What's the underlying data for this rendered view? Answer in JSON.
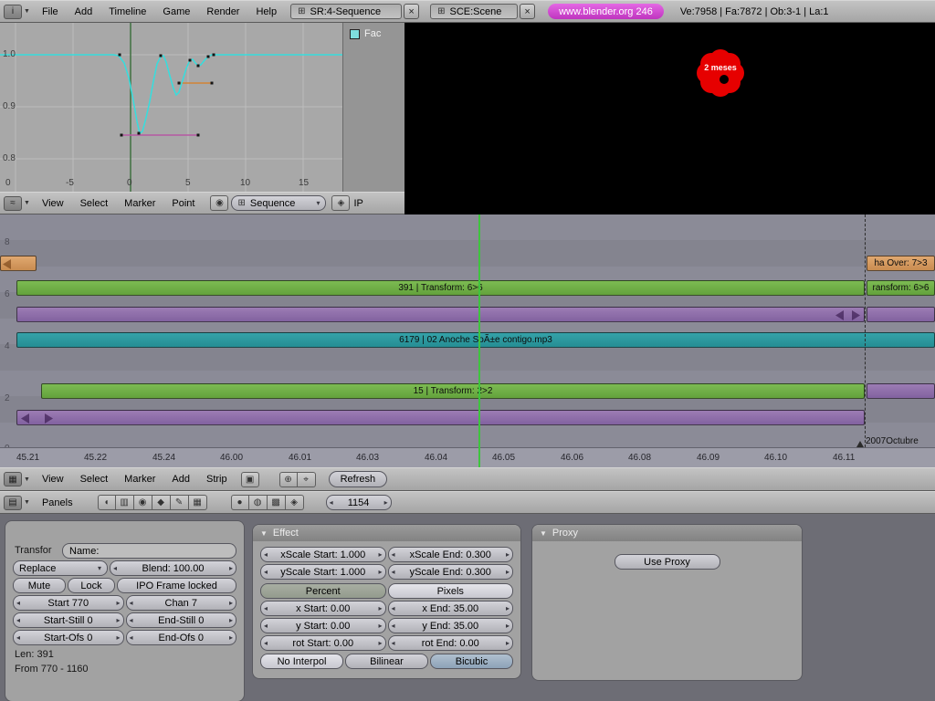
{
  "top_header": {
    "menus": [
      "File",
      "Add",
      "Timeline",
      "Game",
      "Render",
      "Help"
    ],
    "screen_selector": {
      "value": "SR:4-Sequence"
    },
    "scene_selector": {
      "value": "SCE:Scene"
    },
    "version_badge": "www.blender.org 246",
    "stats": "Ve:7958 | Fa:7872 | Ob:3-1 | La:1"
  },
  "ipo_editor": {
    "y_axis_labels": [
      "1.0",
      "0.9",
      "0.8"
    ],
    "x_axis_labels": [
      "0",
      "-5",
      "0",
      "5",
      "10",
      "15"
    ],
    "channels": [
      {
        "name": "Fac",
        "color": "#7fdede"
      }
    ],
    "header": {
      "menus": [
        "View",
        "Select",
        "Marker",
        "Point"
      ],
      "mode_dropdown": "Sequence",
      "id_prefix": "IP"
    }
  },
  "preview": {
    "overlay_label": "2 meses"
  },
  "sequencer": {
    "channel_labels": [
      "8",
      "6",
      "4",
      "2",
      "0"
    ],
    "strips": [
      {
        "label": ""
      },
      {
        "label": "ha Over: 7>3"
      },
      {
        "label": "391 | Transform: 6>6"
      },
      {
        "label": "ransform: 6>6"
      },
      {
        "label": ""
      },
      {
        "label": ""
      },
      {
        "label": "6179 | 02 Anoche SoÃ±e contigo.mp3"
      },
      {
        "label": "15 | Transform: 2>2"
      },
      {
        "label": ""
      },
      {
        "label": ""
      }
    ],
    "ruler_labels": [
      "45.21",
      "45.22",
      "45.24",
      "46.00",
      "46.01",
      "46.03",
      "46.04",
      "46.05",
      "46.06",
      "46.08",
      "46.09",
      "46.10",
      "46.11"
    ],
    "marker_label": "2007Octubre",
    "header": {
      "menus": [
        "View",
        "Select",
        "Marker",
        "Add",
        "Strip"
      ],
      "refresh_button": "Refresh"
    }
  },
  "buttons_header": {
    "panels_label": "Panels",
    "frame_field": "1154"
  },
  "properties": {
    "transform_panel": {
      "type_label": "Transfor",
      "name_field": "Name:",
      "blend_mode": "Replace",
      "blend_value": "Blend: 100.00",
      "mute": "Mute",
      "lock": "Lock",
      "ipo_locked": "IPO Frame locked",
      "start": "Start 770",
      "channel": "Chan 7",
      "start_still": "Start-Still 0",
      "end_still": "End-Still 0",
      "start_ofs": "Start-Ofs 0",
      "end_ofs": "End-Ofs 0",
      "len_info": "Len: 391",
      "range_info": "From 770 - 1160"
    },
    "effect_panel": {
      "title": "Effect",
      "xscale_start": "xScale Start: 1.000",
      "xscale_end": "xScale End: 0.300",
      "yscale_start": "yScale Start: 1.000",
      "yscale_end": "yScale End: 0.300",
      "percent": "Percent",
      "pixels": "Pixels",
      "x_start": "x Start: 0.00",
      "x_end": "x End: 35.00",
      "y_start": "y Start: 0.00",
      "y_end": "y End: 35.00",
      "rot_start": "rot Start: 0.00",
      "rot_end": "rot End: 0.00",
      "no_interpol": "No Interpol",
      "bilinear": "Bilinear",
      "bicubic": "Bicubic"
    },
    "proxy_panel": {
      "title": "Proxy",
      "use_proxy_button": "Use Proxy"
    }
  }
}
